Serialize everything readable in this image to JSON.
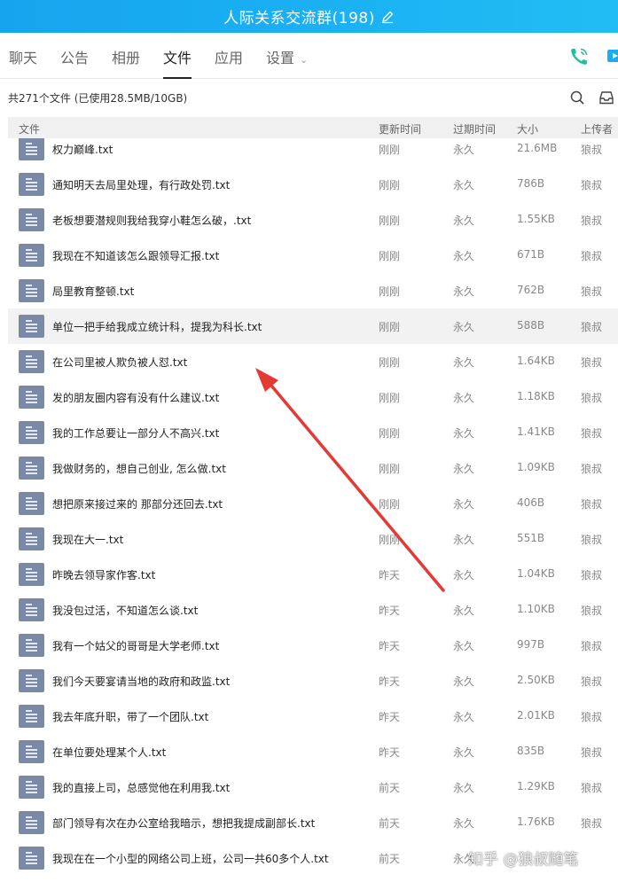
{
  "window": {
    "title": "人际关系交流群(198)"
  },
  "tabs": [
    {
      "label": "聊天"
    },
    {
      "label": "公告"
    },
    {
      "label": "相册"
    },
    {
      "label": "文件",
      "active": true
    },
    {
      "label": "应用"
    },
    {
      "label": "设置"
    }
  ],
  "summary": "共271个文件 (已使用28.5MB/10GB)",
  "columns": {
    "name": "文件",
    "time": "更新时间",
    "expire": "过期时间",
    "size": "大小",
    "uploader": "上传者"
  },
  "files": [
    {
      "name": "权力巅峰.txt",
      "time": "刚刚",
      "expire": "永久",
      "size": "21.6MB",
      "uploader": "狼叔"
    },
    {
      "name": "通知明天去局里处理，有行政处罚.txt",
      "time": "刚刚",
      "expire": "永久",
      "size": "786B",
      "uploader": "狼叔"
    },
    {
      "name": "老板想要潜规则我给我穿小鞋怎么破，.txt",
      "time": "刚刚",
      "expire": "永久",
      "size": "1.55KB",
      "uploader": "狼叔"
    },
    {
      "name": "我现在不知道该怎么跟领导汇报.txt",
      "time": "刚刚",
      "expire": "永久",
      "size": "671B",
      "uploader": "狼叔"
    },
    {
      "name": "局里教育整顿.txt",
      "time": "刚刚",
      "expire": "永久",
      "size": "762B",
      "uploader": "狼叔"
    },
    {
      "name": "单位一把手给我成立统计科，提我为科长.txt",
      "time": "刚刚",
      "expire": "永久",
      "size": "588B",
      "uploader": "狼叔",
      "highlight": true
    },
    {
      "name": "在公司里被人欺负被人怼.txt",
      "time": "刚刚",
      "expire": "永久",
      "size": "1.64KB",
      "uploader": "狼叔"
    },
    {
      "name": "发的朋友圈内容有没有什么建议.txt",
      "time": "刚刚",
      "expire": "永久",
      "size": "1.18KB",
      "uploader": "狼叔"
    },
    {
      "name": "我的工作总要让一部分人不高兴.txt",
      "time": "刚刚",
      "expire": "永久",
      "size": "1.41KB",
      "uploader": "狼叔"
    },
    {
      "name": "我做财务的，想自己创业, 怎么做.txt",
      "time": "刚刚",
      "expire": "永久",
      "size": "1.09KB",
      "uploader": "狼叔"
    },
    {
      "name": "想把原来接过来的 那部分还回去.txt",
      "time": "刚刚",
      "expire": "永久",
      "size": "406B",
      "uploader": "狼叔"
    },
    {
      "name": "我现在大一.txt",
      "time": "刚刚",
      "expire": "永久",
      "size": "551B",
      "uploader": "狼叔"
    },
    {
      "name": "昨晚去领导家作客.txt",
      "time": "昨天",
      "expire": "永久",
      "size": "1.04KB",
      "uploader": "狼叔"
    },
    {
      "name": "我没包过活，不知道怎么谈.txt",
      "time": "昨天",
      "expire": "永久",
      "size": "1.10KB",
      "uploader": "狼叔"
    },
    {
      "name": "我有一个姑父的哥哥是大学老师.txt",
      "time": "昨天",
      "expire": "永久",
      "size": "997B",
      "uploader": "狼叔"
    },
    {
      "name": "我们今天要宴请当地的政府和政监.txt",
      "time": "昨天",
      "expire": "永久",
      "size": "2.50KB",
      "uploader": "狼叔"
    },
    {
      "name": "我去年底升职，带了一个团队.txt",
      "time": "昨天",
      "expire": "永久",
      "size": "2.01KB",
      "uploader": "狼叔"
    },
    {
      "name": "在单位要处理某个人.txt",
      "time": "昨天",
      "expire": "永久",
      "size": "835B",
      "uploader": "狼叔"
    },
    {
      "name": "我的直接上司，总感觉他在利用我.txt",
      "time": "前天",
      "expire": "永久",
      "size": "1.29KB",
      "uploader": "狼叔"
    },
    {
      "name": "部门领导有次在办公室给我暗示，想把我提成副部长.txt",
      "time": "前天",
      "expire": "永久",
      "size": "1.76KB",
      "uploader": "狼叔"
    },
    {
      "name": "我现在在一个小型的网络公司上班，公司一共60多个人.txt",
      "time": "前天",
      "expire": "永久",
      "size": "",
      "uploader": ""
    }
  ],
  "watermark": "知乎 @狼叔随笔",
  "colors": {
    "titlebar": "#1aaef0",
    "file_icon": "#7a8aa6",
    "arrow": "#e53935",
    "phone_icon": "#19c3a0"
  },
  "icons": {
    "edit": "pencil-edit-icon",
    "phone": "phone-icon",
    "video": "video-call-icon",
    "search": "search-icon",
    "inbox": "inbox-icon",
    "file": "txt-file-icon",
    "dropdown": "chevron-down-icon"
  }
}
